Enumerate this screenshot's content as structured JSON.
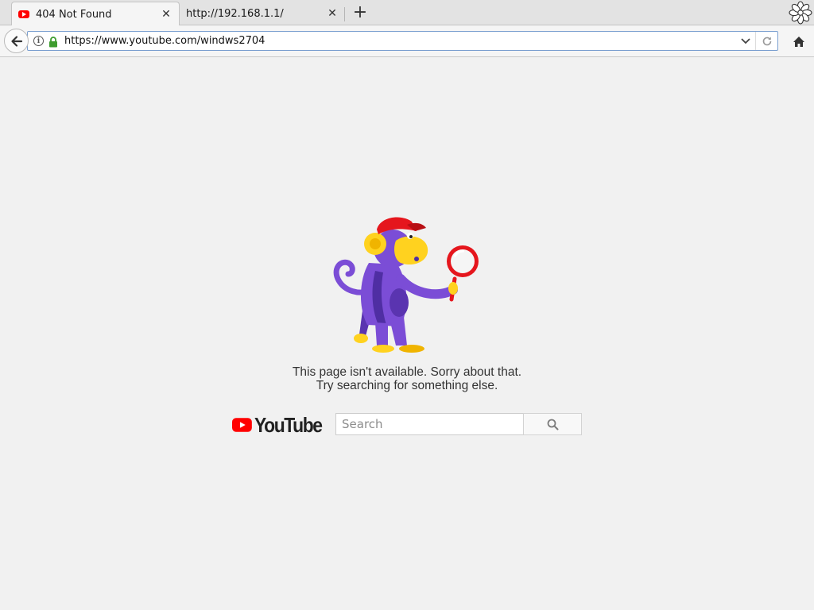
{
  "tabs": [
    {
      "title": "404 Not Found",
      "active": true,
      "favicon": "youtube-favicon-icon"
    },
    {
      "title": "http://192.168.1.1/",
      "active": false
    }
  ],
  "toolbar": {
    "new_tab_symbol": "+",
    "url": "https://www.youtube.com/windws2704",
    "info_symbol": "i"
  },
  "page": {
    "error_line1": "This page isn't available. Sorry about that.",
    "error_line2": "Try searching for something else.",
    "logo_text": "YouTube",
    "search_placeholder": "Search",
    "search_value": ""
  },
  "colors": {
    "youtube_red": "#ff0000",
    "monkey_purple": "#7b4dd6",
    "monkey_yellow": "#ffd21f",
    "cap_red": "#e5161d"
  }
}
